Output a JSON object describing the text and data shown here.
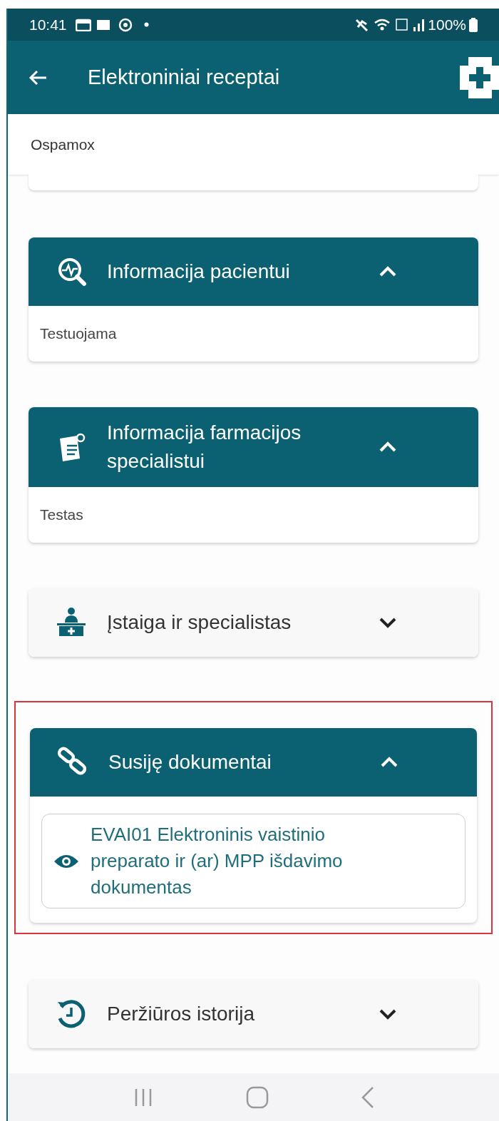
{
  "status_bar": {
    "time": "10:41",
    "battery": "100%"
  },
  "header": {
    "title": "Elektroniniai receptai"
  },
  "top_card": {
    "text": "Ospamox"
  },
  "sections": [
    {
      "title": "Informacija pacientui",
      "expanded": true,
      "highlighted": false,
      "body": "Testuojama"
    },
    {
      "title": "Informacija farmacijos specialistui",
      "expanded": true,
      "highlighted": false,
      "body": "Testas"
    },
    {
      "title": "Įstaiga ir specialistas",
      "expanded": false,
      "highlighted": false
    },
    {
      "title": "Susiję dokumentai",
      "expanded": true,
      "highlighted": true,
      "documents": [
        "EVAI01 Elektroninis vaistinio preparato ir (ar) MPP išdavimo dokumentas"
      ]
    },
    {
      "title": "Peržiūros istorija",
      "expanded": false,
      "highlighted": false
    }
  ]
}
